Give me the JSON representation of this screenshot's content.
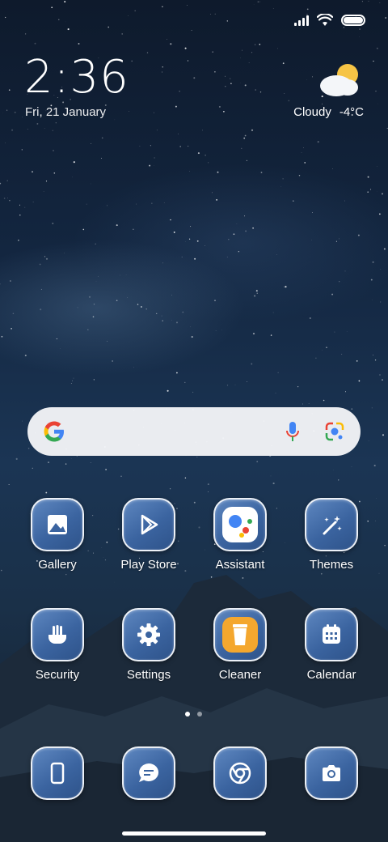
{
  "status_bar": {
    "signal_icon": "signal-icon",
    "wifi_icon": "wifi-icon",
    "battery_icon": "battery-icon"
  },
  "clock": {
    "time": "2:36",
    "date": "Fri, 21 January"
  },
  "weather": {
    "icon": "partly-cloudy-icon",
    "condition": "Cloudy",
    "temperature": "-4°C"
  },
  "search_bar": {
    "logo": "google-logo-icon",
    "mic_icon": "microphone-icon",
    "lens_icon": "lens-icon"
  },
  "apps": [
    {
      "label": "Gallery",
      "icon": "gallery-icon"
    },
    {
      "label": "Play Store",
      "icon": "play-store-icon"
    },
    {
      "label": "Assistant",
      "icon": "assistant-icon"
    },
    {
      "label": "Themes",
      "icon": "themes-icon"
    },
    {
      "label": "Security",
      "icon": "security-icon"
    },
    {
      "label": "Settings",
      "icon": "gear-icon"
    },
    {
      "label": "Cleaner",
      "icon": "cleaner-icon"
    },
    {
      "label": "Calendar",
      "icon": "calendar-icon"
    }
  ],
  "page_indicator": {
    "pages": 2,
    "active": 1
  },
  "dock": [
    {
      "icon": "phone-icon"
    },
    {
      "icon": "messages-icon"
    },
    {
      "icon": "chrome-icon"
    },
    {
      "icon": "camera-icon"
    }
  ],
  "colors": {
    "icon_tile": "#3b64a0",
    "wallpaper": "#132640"
  }
}
